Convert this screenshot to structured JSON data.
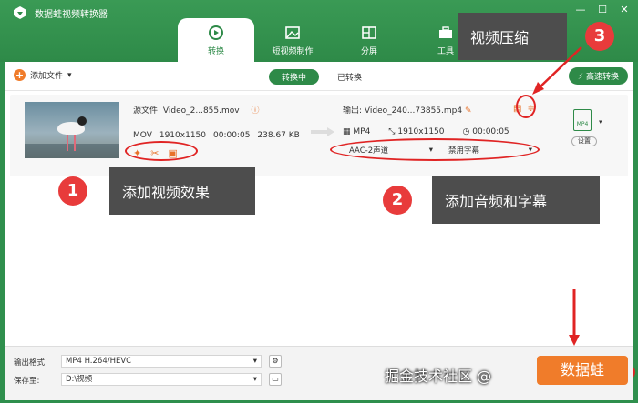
{
  "window": {
    "title": "数据蛙视频转换器",
    "controls": [
      "—",
      "☐",
      "✕"
    ]
  },
  "tabs": [
    {
      "label": "转换",
      "icon": "convert-icon"
    },
    {
      "label": "短视频制作",
      "icon": "image-icon"
    },
    {
      "label": "分屏",
      "icon": "split-screen-icon"
    },
    {
      "label": "工具",
      "icon": "toolbox-icon"
    }
  ],
  "toolbar": {
    "add_file": "添加文件",
    "converting": "转换中",
    "converted": "已转换",
    "fast": "高速转换"
  },
  "file": {
    "source_prefix": "源文件:",
    "source_name": "Video_2...855.mov",
    "format": "MOV",
    "resolution": "1910x1150",
    "duration": "00:00:05",
    "size": "238.67 KB",
    "output_prefix": "输出:",
    "output_name": "Video_240...73855.mp4",
    "out_format": "MP4",
    "out_resolution": "1910x1150",
    "out_duration": "00:00:05",
    "audio": "AAC-2声道",
    "subtitle": "禁用字幕",
    "badge": "MP4",
    "settings": "设置"
  },
  "callouts": [
    {
      "num": "1",
      "text": "添加视频效果"
    },
    {
      "num": "2",
      "text": "添加音频和字幕"
    },
    {
      "num": "3",
      "text": "视频压缩"
    }
  ],
  "footer": {
    "format_label": "输出格式:",
    "format_value": "MP4 H.264/HEVC",
    "save_label": "保存至:",
    "save_value": "D:\\视频",
    "convert": "数据蛙",
    "watermark": "掘金技术社区 @"
  },
  "colors": {
    "brand": "#2e8a48",
    "accent": "#f07c2a",
    "annot": "#e02424"
  }
}
